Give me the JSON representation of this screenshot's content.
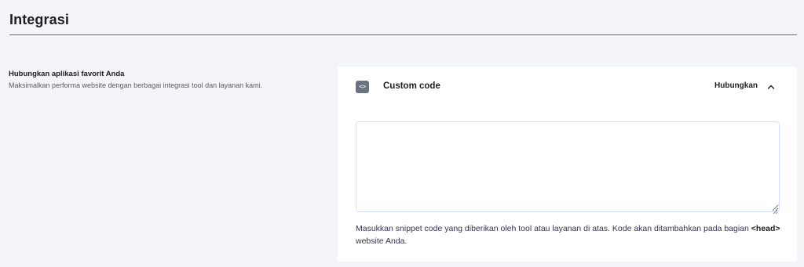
{
  "header": {
    "title": "Integrasi"
  },
  "section": {
    "heading": "Hubungkan aplikasi favorit Anda",
    "description": "Maksimalkan performa website dengan berbagai integrasi tool dan layanan kami."
  },
  "card": {
    "icon": "code-icon",
    "icon_glyph": "<>",
    "title": "Custom code",
    "connect_label": "Hubungkan",
    "toggle_state": "expanded",
    "code_value": "",
    "code_placeholder": "",
    "help": {
      "before": "Masukkan snippet code yang diberikan oleh tool atau layanan di atas. Kode akan ditambahkan pada bagian ",
      "tag": "<head>",
      "after": " website Anda."
    }
  },
  "colors": {
    "page_bg": "#f4f5f9",
    "card_bg": "#ffffff",
    "icon_bg": "#6d7081",
    "text_dark": "#1d1e20",
    "input_border": "#d5dfff"
  }
}
